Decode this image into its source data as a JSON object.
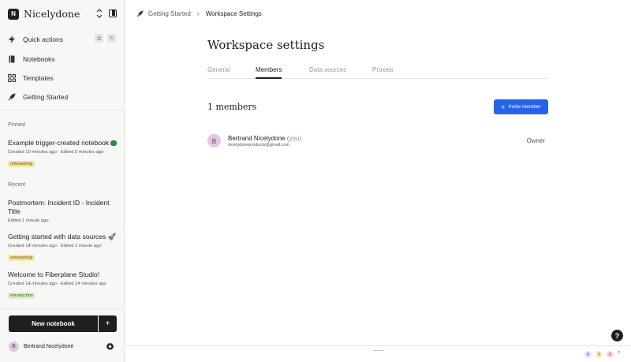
{
  "workspace": {
    "logo_letter": "N",
    "name": "Nicelydone"
  },
  "nav": {
    "quick_actions": {
      "label": "Quick actions",
      "kbd": [
        "⌘",
        "K"
      ]
    },
    "notebooks": "Notebooks",
    "templates": "Templates",
    "getting_started": "Getting Started"
  },
  "pinned": {
    "label": "Pinned",
    "items": [
      {
        "title": "Example trigger-created notebook",
        "meta": "Created 10 minutes ago · Edited 5 minutes ago",
        "tag": "onboarding"
      }
    ]
  },
  "recent": {
    "label": "Recent",
    "items": [
      {
        "title": "Postmortem: Incident ID - Incident Title",
        "meta": "Edited 1 minute ago"
      },
      {
        "title": "Getting started with data sources 🚀",
        "meta": "Created 14 minutes ago · Edited 1 minute ago",
        "tag": "onboarding"
      },
      {
        "title": "Welcome to Fiberplane Studio!",
        "meta": "Created 14 minutes ago · Edited 14 minutes ago",
        "tag": "introduction"
      }
    ]
  },
  "new_notebook": {
    "label": "New notebook",
    "plus": "+"
  },
  "user": {
    "initial": "B",
    "name": "Bertrand Nicelydone"
  },
  "breadcrumb": {
    "parent": "Getting Started",
    "separator": "›",
    "current": "Workspace Settings"
  },
  "page": {
    "title": "Workspace settings",
    "tabs": [
      "General",
      "Members",
      "Data sources",
      "Proxies"
    ],
    "active_tab": "Members",
    "members_count": "1 members",
    "invite_label": "Invite member"
  },
  "members": [
    {
      "initial": "B",
      "name": "Bertrand Nicelydone",
      "you": "(you)",
      "email": "nicelydoneproducts@gmail.com",
      "role": "Owner"
    }
  ],
  "status": {
    "help": "?",
    "counters": [
      "0",
      "0",
      "0"
    ],
    "caret": "^"
  },
  "colors": {
    "accent": "#2563eb",
    "dark": "#1f1f1f",
    "sidebar_bg": "#f7f7f6"
  }
}
